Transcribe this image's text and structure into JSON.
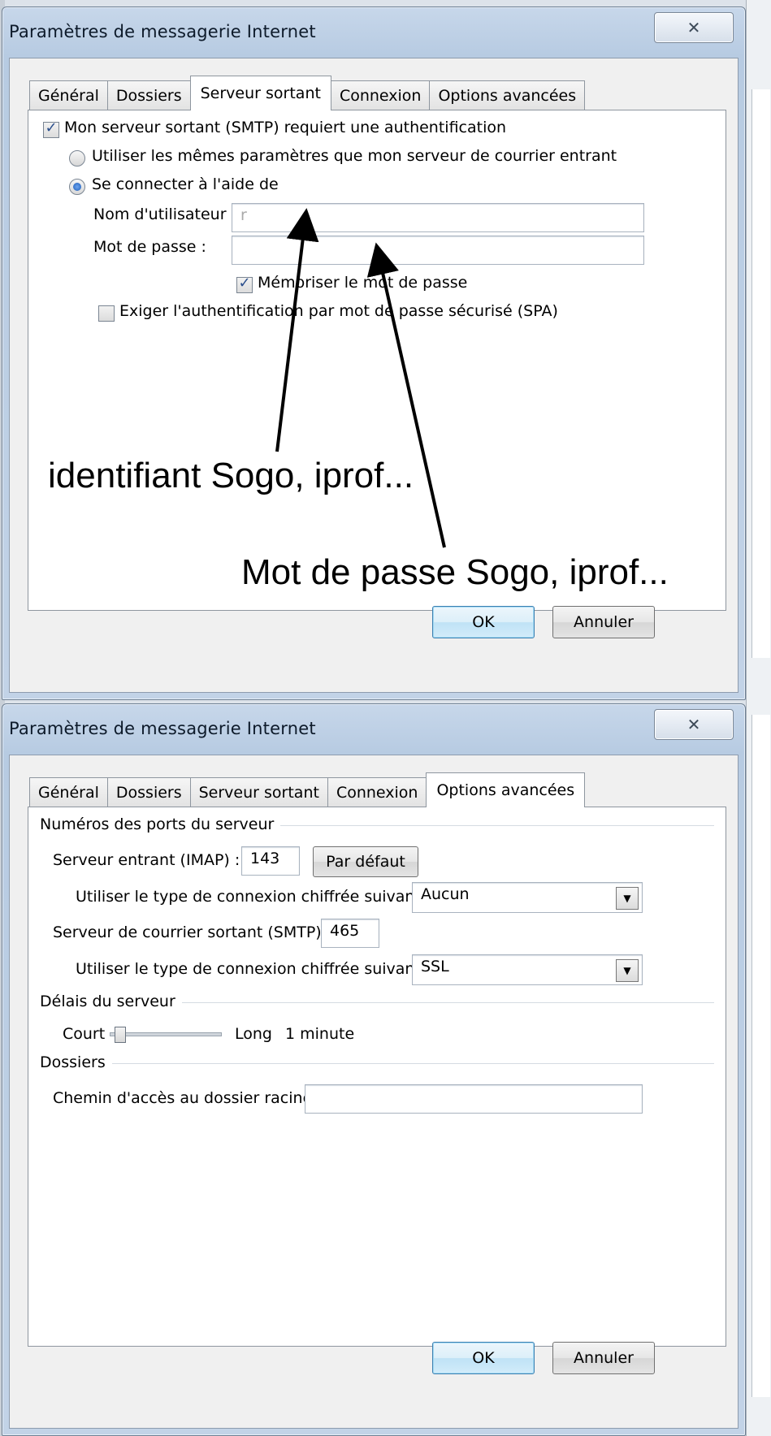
{
  "dialog1": {
    "title": "Paramètres de messagerie Internet",
    "close": "✕",
    "tabs": [
      "Général",
      "Dossiers",
      "Serveur sortant",
      "Connexion",
      "Options avancées"
    ],
    "active_tab": "Serveur sortant",
    "smtp_auth_label": "Mon serveur sortant (SMTP) requiert une authentification",
    "same_settings_label": "Utiliser les mêmes paramètres que mon serveur de courrier entrant",
    "connect_with_label": "Se connecter à l'aide de",
    "username_label": "Nom d'utilisateur :",
    "username_value": "r",
    "password_label": "Mot de passe :",
    "password_value": "",
    "remember_label": "Mémoriser le mot de passe",
    "spa_label": "Exiger l'authentification par mot de passe sécurisé (SPA)",
    "annotation_user": "identifiant Sogo, iprof...",
    "annotation_pass": "Mot de passe Sogo, iprof...",
    "ok": "OK",
    "cancel": "Annuler"
  },
  "dialog2": {
    "title": "Paramètres de messagerie Internet",
    "close": "✕",
    "tabs": [
      "Général",
      "Dossiers",
      "Serveur sortant",
      "Connexion",
      "Options avancées"
    ],
    "active_tab": "Options avancées",
    "ports_group": "Numéros des ports du serveur",
    "incoming_label": "Serveur entrant (IMAP) :",
    "incoming_port": "143",
    "default_button": "Par défaut",
    "enc_label_in": "Utiliser le type de connexion chiffrée suivant :",
    "enc_value_in": "Aucun",
    "outgoing_label": "Serveur de courrier sortant (SMTP) :",
    "outgoing_port": "465",
    "enc_label_out": "Utiliser le type de connexion chiffrée suivant :",
    "enc_value_out": "SSL",
    "timeout_group": "Délais du serveur",
    "timeout_short": "Court",
    "timeout_long": "Long",
    "timeout_value": "1 minute",
    "timeout_level": 0.05,
    "folders_group": "Dossiers",
    "root_path_label": "Chemin d'accès au dossier racine :",
    "root_path_value": "",
    "ok": "OK",
    "cancel": "Annuler"
  }
}
